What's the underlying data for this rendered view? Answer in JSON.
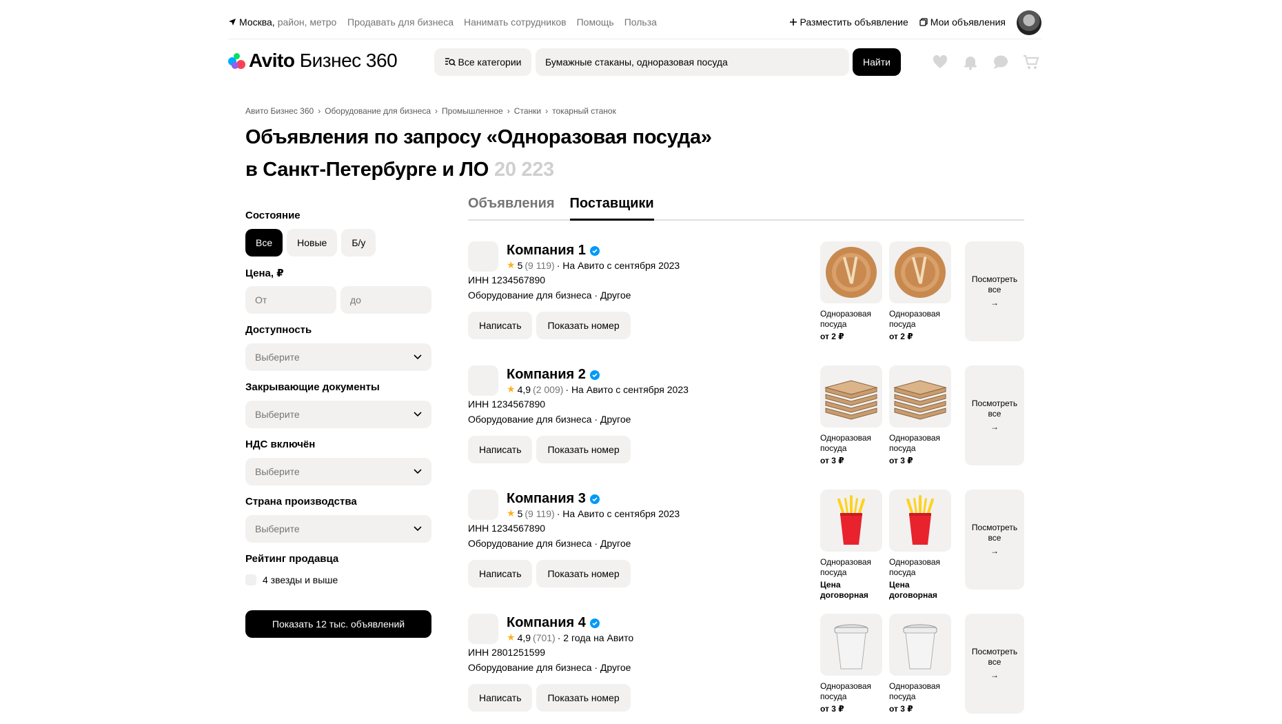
{
  "topbar": {
    "location_city": "Москва,",
    "location_rest": "район, метро",
    "links": [
      "Продавать для бизнеса",
      "Нанимать сотрудников",
      "Помощь",
      "Польза"
    ],
    "post_ad": "Разместить объявление",
    "my_ads": "Мои объявления"
  },
  "header": {
    "logo_brand": "Avito",
    "logo_suffix": "Бизнес 360",
    "categories_label": "Все категории",
    "search_value": "Бумажные стаканы, одноразовая посуда",
    "find_label": "Найти"
  },
  "breadcrumbs": [
    "Авито Бизнес 360",
    "Оборудование для бизнеса",
    "Промышленное",
    "Станки",
    "токарный станок"
  ],
  "title": {
    "line1": "Объявления по запросу «Одноразовая посуда»",
    "line2": "в Санкт-Петербурге и ЛО",
    "count": "20 223"
  },
  "tabs": [
    {
      "label": "Объявления",
      "active": false
    },
    {
      "label": "Поставщики",
      "active": true
    }
  ],
  "filters": {
    "condition": {
      "label": "Состояние",
      "options": [
        "Все",
        "Новые",
        "Б/у"
      ],
      "selected": "Все"
    },
    "price": {
      "label": "Цена, ₽",
      "from_placeholder": "От",
      "to_placeholder": "до"
    },
    "availability": {
      "label": "Доступность",
      "value": "Выберите"
    },
    "documents": {
      "label": "Закрывающие документы",
      "value": "Выберите"
    },
    "vat": {
      "label": "НДС включён",
      "value": "Выберите"
    },
    "country": {
      "label": "Страна производства",
      "value": "Выберите"
    },
    "rating": {
      "label": "Рейтинг продавца",
      "option": "4 звезды и выше",
      "checked": false
    },
    "show_button": "Показать 12 тыс. объявлений"
  },
  "suppliers": [
    {
      "name": "Компания 1",
      "rating": "5",
      "reviews": "(9 119)",
      "since": "· На Авито с сентября 2023",
      "inn": "ИНН 1234567890",
      "category": "Оборудование для бизнеса · Другое",
      "write_label": "Написать",
      "phone_label": "Показать номер",
      "products": [
        {
          "name_1": "Одноразовая",
          "name_2": "посуда",
          "price_1": "от 2 ₽",
          "price_2": "",
          "icon": "plate-icon"
        },
        {
          "name_1": "Одноразовая",
          "name_2": "посуда",
          "price_1": "от 2 ₽",
          "price_2": "",
          "icon": "plate-icon"
        }
      ],
      "see_all_1": "Посмотреть",
      "see_all_2": "все"
    },
    {
      "name": "Компания 2",
      "rating": "4,9",
      "reviews": "(2 009)",
      "since": "· На Авито с сентября 2023",
      "inn": "ИНН 1234567890",
      "category": "Оборудование для бизнеса · Другое",
      "write_label": "Написать",
      "phone_label": "Показать номер",
      "products": [
        {
          "name_1": "Одноразовая",
          "name_2": "посуда",
          "price_1": "от 3 ₽",
          "price_2": "",
          "icon": "pizza-box-icon"
        },
        {
          "name_1": "Одноразовая",
          "name_2": "посуда",
          "price_1": "от 3 ₽",
          "price_2": "",
          "icon": "pizza-box-icon"
        }
      ],
      "see_all_1": "Посмотреть",
      "see_all_2": "все"
    },
    {
      "name": "Компания 3",
      "rating": "5",
      "reviews": "(9 119)",
      "since": "· На Авито с сентября 2023",
      "inn": "ИНН 1234567890",
      "category": "Оборудование для бизнеса · Другое",
      "write_label": "Написать",
      "phone_label": "Показать номер",
      "products": [
        {
          "name_1": "Одноразовая",
          "name_2": "посуда",
          "price_1": "Цена",
          "price_2": "договорная",
          "icon": "cup-forks-icon"
        },
        {
          "name_1": "Одноразовая",
          "name_2": "посуда",
          "price_1": "Цена",
          "price_2": "договорная",
          "icon": "cup-forks-icon"
        }
      ],
      "see_all_1": "Посмотреть",
      "see_all_2": "все"
    },
    {
      "name": "Компания 4",
      "rating": "4,9",
      "reviews": "(701)",
      "since": "· 2 года на Авито",
      "inn": "ИНН 2801251599",
      "category": "Оборудование для бизнеса · Другое",
      "write_label": "Написать",
      "phone_label": "Показать номер",
      "products": [
        {
          "name_1": "Одноразовая",
          "name_2": "посуда",
          "price_1": "от 3 ₽",
          "price_2": "",
          "icon": "paper-cup-icon"
        },
        {
          "name_1": "Одноразовая",
          "name_2": "посуда",
          "price_1": "от 3 ₽",
          "price_2": "",
          "icon": "paper-cup-icon"
        }
      ],
      "see_all_1": "Посмотреть",
      "see_all_2": "все"
    }
  ],
  "colors": {
    "accent": "#000000",
    "surface": "#f2f1f0",
    "muted": "#757575",
    "star": "#ffb021",
    "verified": "#0099f7"
  }
}
